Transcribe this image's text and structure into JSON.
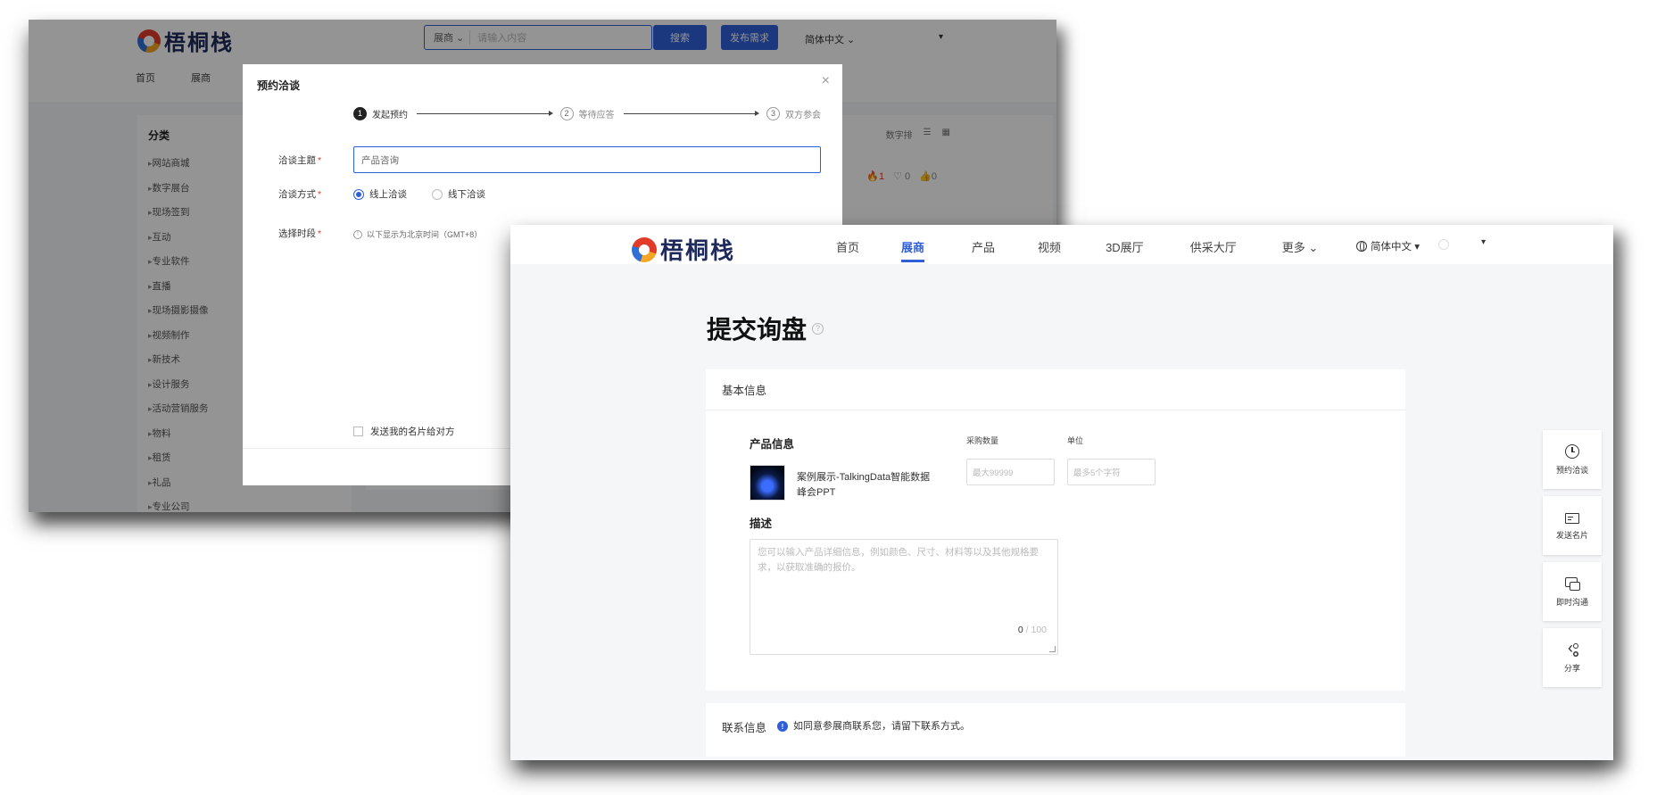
{
  "back_window": {
    "logo_text": "梧桐栈",
    "search": {
      "select_label": "展商 ⌄",
      "placeholder": "请输入内容"
    },
    "search_button": "搜索",
    "publish_button": "发布需求",
    "language": "简体中文 ⌄",
    "user_caret": "▾",
    "nav": [
      {
        "label": "首页"
      },
      {
        "label": "展商"
      }
    ],
    "sidebar": {
      "title": "分类",
      "items": [
        {
          "label": "网站商城"
        },
        {
          "label": "数字展台"
        },
        {
          "label": "现场签到"
        },
        {
          "label": "互动"
        },
        {
          "label": "专业软件"
        },
        {
          "label": "直播"
        },
        {
          "label": "现场摄影摄像"
        },
        {
          "label": "视频制作"
        },
        {
          "label": "新技术"
        },
        {
          "label": "设计服务"
        },
        {
          "label": "活动营销服务"
        },
        {
          "label": "物料"
        },
        {
          "label": "租赁"
        },
        {
          "label": "礼品"
        },
        {
          "label": "专业公司"
        }
      ]
    },
    "sort": {
      "label": "数字排"
    },
    "stats": {
      "hot": "1",
      "likes": "0",
      "thumbs": "0"
    },
    "modal": {
      "title": "预约洽谈",
      "close": "×",
      "steps": [
        {
          "num": "1",
          "label": "发起预约"
        },
        {
          "num": "2",
          "label": "等待应答"
        },
        {
          "num": "3",
          "label": "双方参会"
        }
      ],
      "topic_label": "洽谈主题",
      "topic_value": "产品咨询",
      "method_label": "洽谈方式",
      "method_options": [
        {
          "label": "线上洽谈",
          "selected": true
        },
        {
          "label": "线下洽谈",
          "selected": false
        }
      ],
      "time_label": "选择时段",
      "tz_note": "以下显示为北京时间（GMT+8）",
      "send_card_label": "发送我的名片给对方"
    }
  },
  "front_window": {
    "logo_text": "梧桐栈",
    "nav": [
      {
        "label": "首页"
      },
      {
        "label": "展商"
      },
      {
        "label": "产品"
      },
      {
        "label": "视频"
      },
      {
        "label": "3D展厅"
      },
      {
        "label": "供采大厅"
      },
      {
        "label": "更多 ⌄"
      }
    ],
    "active_nav": "展商",
    "language": "简体中文 ▾",
    "user_caret": "▾",
    "page_title": "提交询盘",
    "basic_section": {
      "heading": "基本信息",
      "product_label": "产品信息",
      "qty_label": "采购数量",
      "unit_label": "单位",
      "product_name": "案例展示-TalkingData智能数据峰会PPT",
      "qty_placeholder": "最大99999",
      "unit_placeholder": "最多5个字符",
      "desc_label": "描述",
      "desc_placeholder": "您可以输入产品详细信息，例如颜色、尺寸、材料等以及其他规格要求，以获取准确的报价。",
      "desc_count": "0",
      "desc_max": "/ 100"
    },
    "contact_section": {
      "heading": "联系信息",
      "note": "如同意参展商联系您，请留下联系方式。"
    },
    "side_tools": [
      {
        "label": "预约洽谈",
        "icon": "clock-icon"
      },
      {
        "label": "发送名片",
        "icon": "card-icon"
      },
      {
        "label": "即时沟通",
        "icon": "chat-icon"
      },
      {
        "label": "分享",
        "icon": "share-icon"
      }
    ],
    "colors": {
      "accent": "#2f5fd8",
      "required": "#e23b2a"
    }
  }
}
